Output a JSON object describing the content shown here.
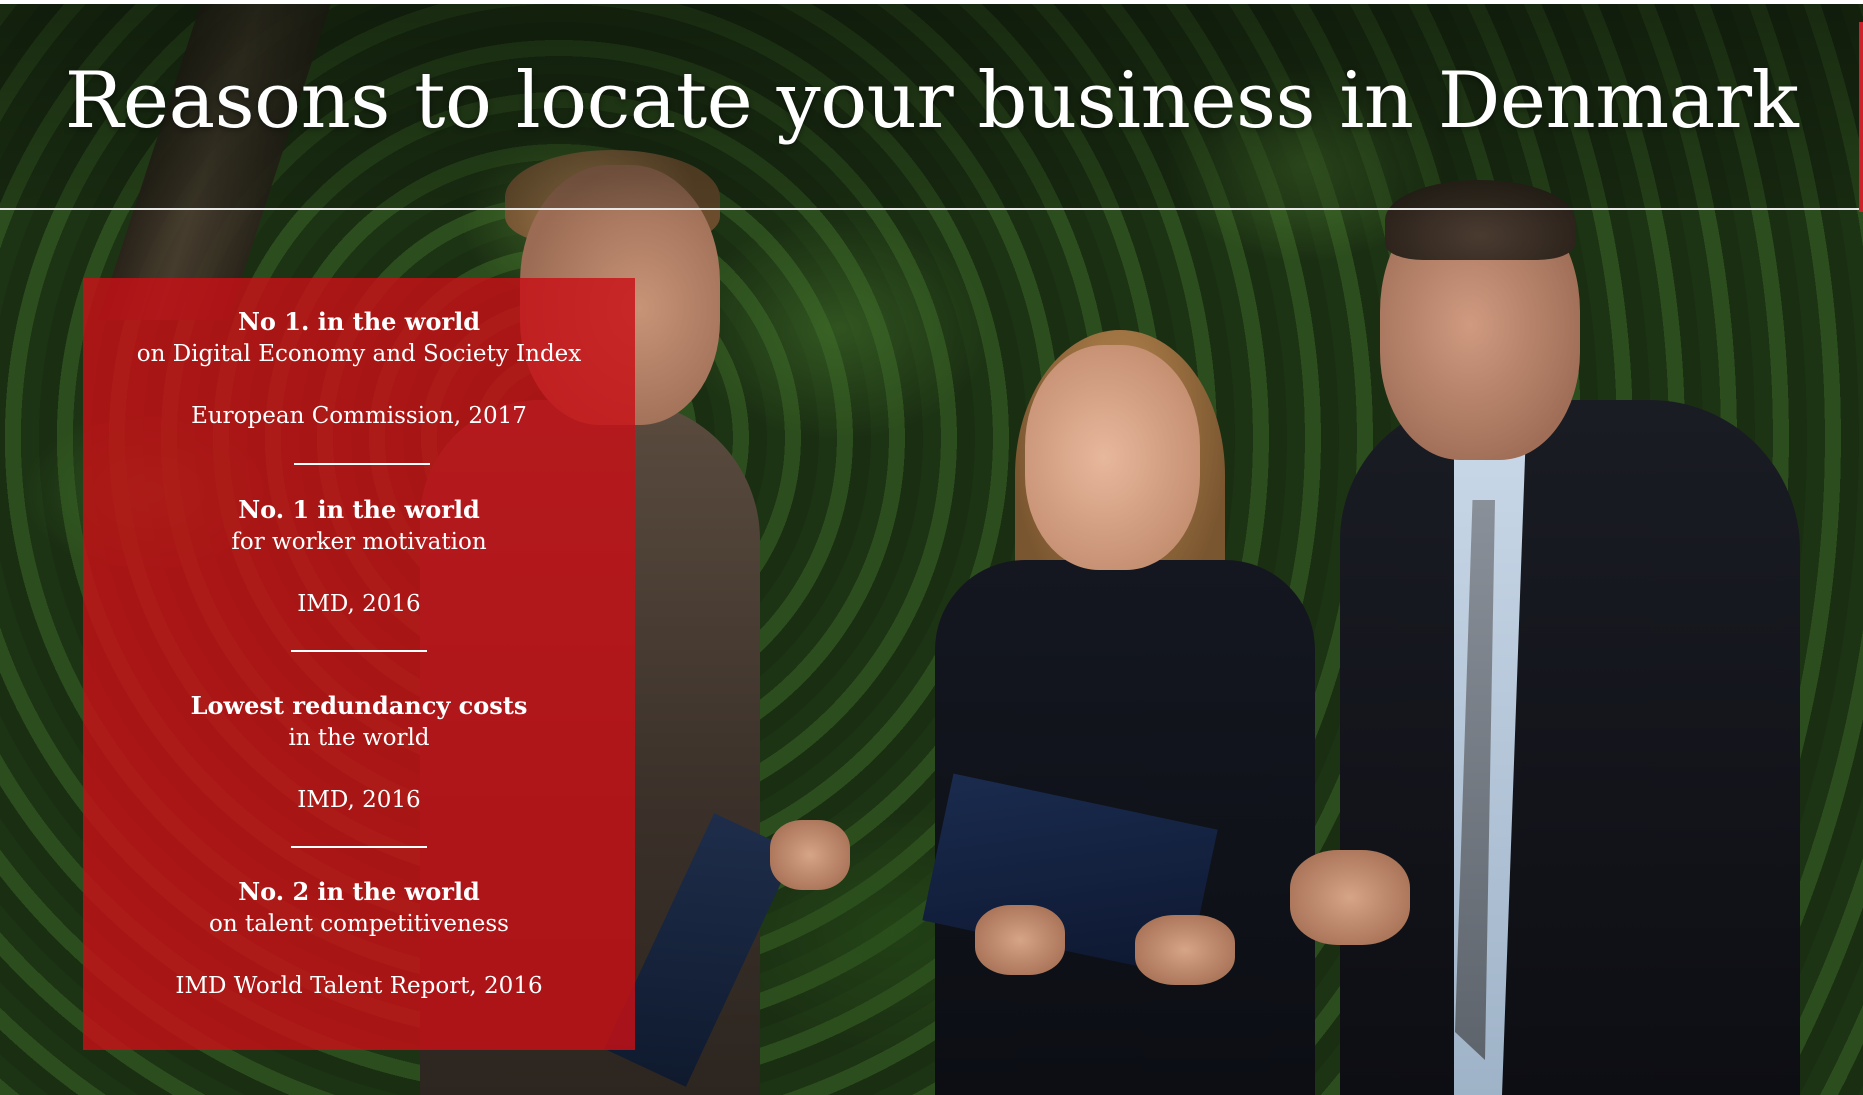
{
  "header": {
    "title": "Reasons to locate your business in Denmark"
  },
  "stats": [
    {
      "headline": "No 1. in the world",
      "detail": "on Digital Economy and Society Index",
      "source": "European Commission, 2017"
    },
    {
      "headline": "No. 1 in the world",
      "detail": "for worker motivation",
      "source": "IMD, 2016"
    },
    {
      "headline": "Lowest redundancy costs",
      "detail": "in the world",
      "source": "IMD, 2016"
    },
    {
      "headline": "No. 2 in the world",
      "detail": "on talent competitiveness",
      "source": "IMD World Talent Report, 2016"
    }
  ],
  "colors": {
    "panel_red": "#c81016",
    "accent_red": "#d0202a",
    "text": "#ffffff"
  }
}
